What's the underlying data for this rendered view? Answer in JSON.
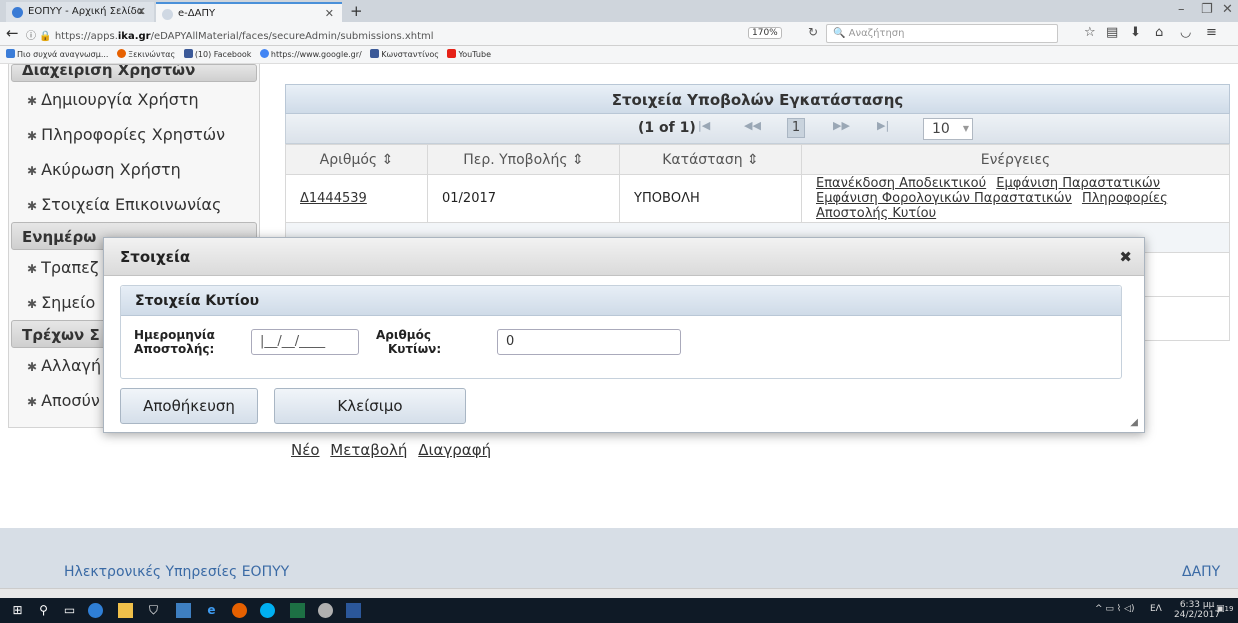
{
  "browser": {
    "tabs": [
      {
        "label": "ΕΟΠΥΥ - Αρχική Σελίδα"
      },
      {
        "label": "e-ΔΑΠΥ"
      }
    ],
    "url_prefix": "https://apps.",
    "url_domain": "ika.gr",
    "url_path": "/eDAPYAllMaterial/faces/secureAdmin/submissions.xhtml",
    "zoom": "170%",
    "search_placeholder": "Αναζήτηση",
    "bookmarks": [
      {
        "label": "Πιο συχνά αναγνωσμ...",
        "color": "#3b7dd8"
      },
      {
        "label": "Ξεκινώντας",
        "color": "#e66000"
      },
      {
        "label": "(10) Facebook",
        "color": "#3b5998"
      },
      {
        "label": "https://www.google.gr/",
        "color": "#4285f4"
      },
      {
        "label": "Κωνσταντίνος",
        "color": "#3b5998"
      },
      {
        "label": "YouTube",
        "color": "#e62117"
      }
    ]
  },
  "sidebar": {
    "header_users": "Διαχείριση Χρηστών",
    "items_users": [
      {
        "label": "Δημιουργία Χρήστη"
      },
      {
        "label": "Πληροφορίες Χρηστών"
      },
      {
        "label": "Ακύρωση Χρήστη"
      },
      {
        "label": "Στοιχεία Επικοινωνίας"
      }
    ],
    "header_update": "Ενημέρω",
    "items_update": [
      {
        "label": "Τραπεζ"
      },
      {
        "label": "Σημείο"
      }
    ],
    "header_current": "Τρέχων Σ",
    "items_current": [
      {
        "label": "Αλλαγή"
      },
      {
        "label": "Αποσύν"
      }
    ]
  },
  "panel": {
    "title": "Στοιχεία Υποβολών Εγκατάστασης",
    "page_info": "(1 of 1)",
    "first": "|◀",
    "prev": "◀◀",
    "page": "1",
    "next": "▶▶",
    "last": "▶|",
    "page_size": "10"
  },
  "table": {
    "headers": [
      "Αριθμός ⇕",
      "Περ. Υποβολής ⇕",
      "Κατάσταση ⇕",
      "Ενέργειες"
    ],
    "rows": [
      {
        "number": "Δ1444539",
        "period": "01/2017",
        "status": "ΥΠΟΒΟΛΗ",
        "actions": [
          "Επανέκδοση Αποδεικτικού",
          "Εμφάνιση Παραστατικών",
          "Εμφάνιση Φορολογικών Παραστατικών",
          "Πληροφορίες Αποστολής Κυτίου"
        ]
      }
    ]
  },
  "bottom_links": [
    "Νέο",
    "Μεταβολή",
    "Διαγραφή"
  ],
  "footer": {
    "left": "Ηλεκτρονικές Υπηρεσίες ΕΟΠΥΥ",
    "right": "ΔΑΠΥ"
  },
  "dialog": {
    "title": "Στοιχεία",
    "close": "✖",
    "section_title": "Στοιχεία Κυτίου",
    "date_label_1": "Ημερομηνία",
    "date_label_2": "Αποστολής:",
    "date_value": "|__/__/____",
    "count_label_1": "Αριθμός",
    "count_label_2": "Κυτίων:",
    "count_value": "0",
    "save_label": "Αποθήκευση",
    "close_label": "Κλείσιμο"
  },
  "taskbar": {
    "lang": "ΕΛ",
    "time": "6:33 μμ",
    "date": "24/2/2017",
    "notification_count": "19"
  }
}
